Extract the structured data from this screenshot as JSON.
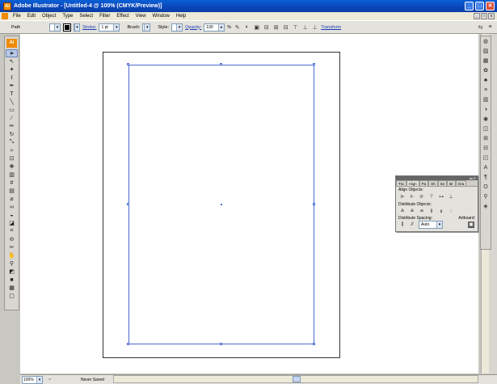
{
  "window": {
    "title": "Adobe Illustrator - [Untitled-4 @ 100% (CMYK/Preview)]",
    "app_icon": "Ai"
  },
  "menu": [
    "File",
    "Edit",
    "Object",
    "Type",
    "Select",
    "Filter",
    "Effect",
    "View",
    "Window",
    "Help"
  ],
  "control": {
    "selection_label": "Path",
    "stroke_label": "Stroke:",
    "stroke_weight": "1 pt",
    "brush_label": "Brush:",
    "style_label": "Style:",
    "opacity_label": "Opacity:",
    "opacity_value": "100",
    "opacity_unit": "%",
    "transform_label": "Transform"
  },
  "toolbar": {
    "logo": "Ai"
  },
  "align_panel": {
    "tabs": [
      "Tra",
      "Align",
      "Pa",
      "Sh",
      "Se",
      "Br",
      "Gra"
    ],
    "active_tab": "Align",
    "align_objects": "Align Objects:",
    "distribute_objects": "Distribute Objects:",
    "distribute_spacing": "Distribute Spacing:",
    "align_to": "Align To:",
    "artboard_label": "Artboard:",
    "spacing_value": "Auto"
  },
  "status": {
    "zoom": "100%",
    "info": "Never Saved"
  }
}
